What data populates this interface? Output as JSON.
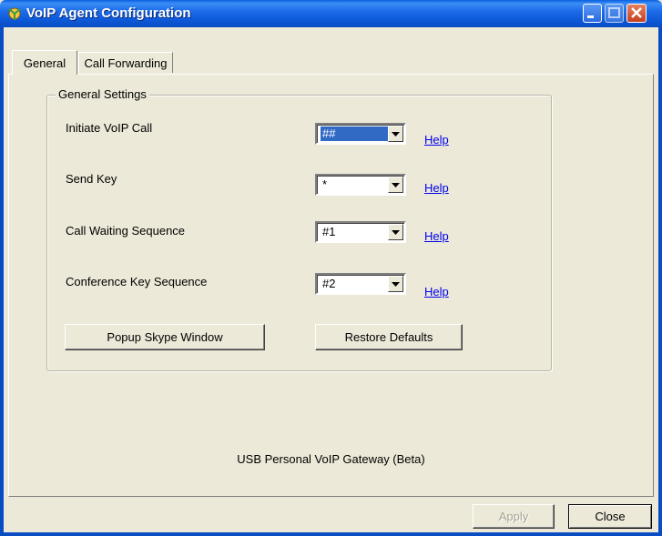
{
  "window": {
    "title": "VoIP Agent Configuration",
    "icon": "voip-agent-app-icon"
  },
  "tabs": [
    {
      "label": "General",
      "selected": true
    },
    {
      "label": "Call Forwarding",
      "selected": false
    }
  ],
  "general_settings": {
    "legend": "General Settings",
    "rows": [
      {
        "label": "Initiate VoIP Call",
        "value": "##",
        "help": "Help"
      },
      {
        "label": "Send Key",
        "value": "*",
        "help": "Help"
      },
      {
        "label": "Call Waiting Sequence",
        "value": "#1",
        "help": "Help"
      },
      {
        "label": "Conference Key Sequence",
        "value": "#2",
        "help": "Help"
      }
    ],
    "popup_button": "Popup Skype Window",
    "restore_button": "Restore Defaults"
  },
  "product_name": "USB Personal VoIP Gateway (Beta)",
  "footer": {
    "apply": "Apply",
    "close": "Close"
  },
  "colors": {
    "titlebar": "#0a58d6",
    "selection": "#316ac5",
    "link": "#0000ee"
  }
}
